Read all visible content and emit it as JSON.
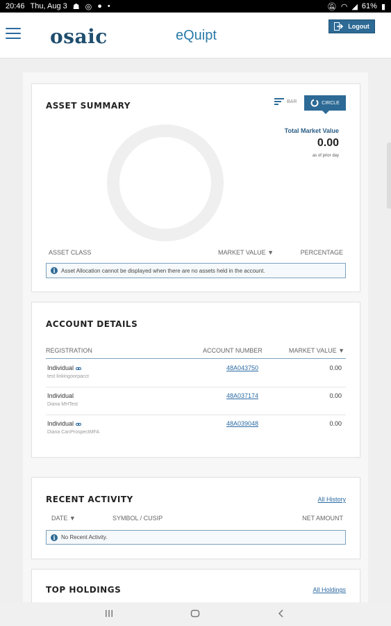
{
  "status_bar": {
    "time": "20:46",
    "date": "Thu, Aug 3",
    "battery": "61%"
  },
  "header": {
    "logo": "osaic",
    "title": "eQuipt",
    "logout_label": "Logout"
  },
  "asset_summary": {
    "title": "ASSET SUMMARY",
    "toggle_bar_label": "BAR",
    "toggle_circle_label": "CIRCLE",
    "total_label": "Total Market Value",
    "total_value": "0.00",
    "as_of": "as of prior day",
    "columns": [
      "ASSET CLASS",
      "MARKET VALUE ▼",
      "PERCENTAGE"
    ],
    "notice": "Asset Allocation cannot be displayed when there are no assets held in the account."
  },
  "account_details": {
    "title": "ACCOUNT DETAILS",
    "columns": [
      "REGISTRATION",
      "ACCOUNT NUMBER",
      "MARKET VALUE ▼"
    ],
    "rows": [
      {
        "registration": "Individual",
        "nickname": "test linkingoorpacct",
        "account": "48A043750",
        "value": "0.00"
      },
      {
        "registration": "Individual",
        "nickname": "Diana MHTest",
        "account": "48A037174",
        "value": "0.00"
      },
      {
        "registration": "Individual",
        "nickname": "Diana CanProspectMFA",
        "account": "48A039048",
        "value": "0.00"
      }
    ]
  },
  "recent_activity": {
    "title": "RECENT ACTIVITY",
    "all_link": "All History",
    "columns": [
      "DATE ▼",
      "SYMBOL / CUSIP",
      "NET AMOUNT"
    ],
    "notice": "No Recent Activity."
  },
  "top_holdings": {
    "title": "TOP HOLDINGS",
    "all_link": "All Holdings"
  },
  "colors": {
    "primary": "#2d6a95",
    "link": "#2a6aa3",
    "background": "#efefef"
  }
}
